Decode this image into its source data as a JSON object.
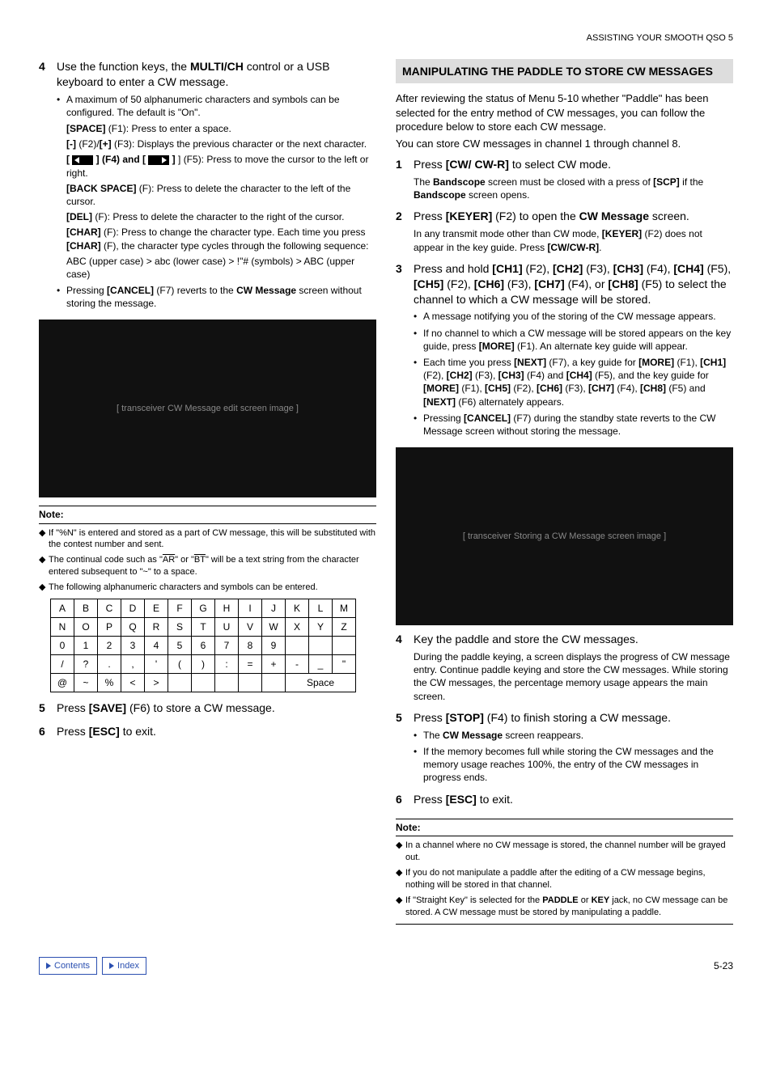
{
  "header": "ASSISTING YOUR SMOOTH QSO 5",
  "left": {
    "step4": {
      "num": "4",
      "head_a": "Use the function keys, the ",
      "head_b": "MULTI/CH",
      "head_c": " control or a USB keyboard to enter a CW message.",
      "b1": "A maximum of 50 alphanumeric characters and symbols can be configured. The default is \"On\".",
      "space_a": "[SPACE]",
      "space_b": " (F1): Press to enter a space.",
      "minus_a": "[-]",
      "minus_b": " (F2)/",
      "minus_c": "[+]",
      "minus_d": " (F3): Displays the previous character or the next character.",
      "arrow_a": "[ ",
      "arrow_b": " ] (F4) and [ ",
      "arrow_c": " ] (F5): Press to move the cursor to the left or right.",
      "back_a": "[BACK SPACE]",
      "back_b": " (F): Press to delete the character to the left of the cursor.",
      "del_a": "[DEL]",
      "del_b": " (F): Press to delete the character to the right of the cursor.",
      "char_a": "[CHAR]",
      "char_b": " (F): Press to change the character type. Each time you press ",
      "char_c": "[CHAR]",
      "char_d": " (F), the character type cycles through the following sequence:",
      "seq": "ABC (upper case) > abc (lower case) > !\"# (symbols) > ABC (upper case)",
      "cancel_a": "Pressing ",
      "cancel_b": "[CANCEL]",
      "cancel_c": " (F7) reverts to the ",
      "cancel_d": "CW Message",
      "cancel_e": " screen without storing the message."
    },
    "img1": "[ transceiver CW Message edit screen image ]",
    "note_head": "Note:",
    "n1": "If \"%N\" is entered and stored as a part of CW message, this will be substituted with the contest number and sent.",
    "n2_a": "The continual code  such as \"",
    "n2_b": "AR",
    "n2_c": "\" or \"",
    "n2_d": "BT",
    "n2_e": "\" will be a text string from the character entered subsequent to \"~\" to a space.",
    "n3": "The following alphanumeric characters and symbols can be entered.",
    "table": [
      [
        "A",
        "B",
        "C",
        "D",
        "E",
        "F",
        "G",
        "H",
        "I",
        "J",
        "K",
        "L",
        "M"
      ],
      [
        "N",
        "O",
        "P",
        "Q",
        "R",
        "S",
        "T",
        "U",
        "V",
        "W",
        "X",
        "Y",
        "Z"
      ],
      [
        "0",
        "1",
        "2",
        "3",
        "4",
        "5",
        "6",
        "7",
        "8",
        "9",
        "",
        "",
        ""
      ],
      [
        "/",
        "?",
        ".",
        ",",
        "'",
        "(",
        ")",
        ":",
        "=",
        "+",
        "-",
        "_",
        "\""
      ],
      [
        "@",
        "~",
        "%",
        "<",
        ">",
        "",
        "",
        "",
        "",
        "",
        "Space",
        "",
        ""
      ]
    ],
    "step5": {
      "num": "5",
      "a": "Press ",
      "b": "[SAVE]",
      "c": " (F6) to store a CW message."
    },
    "step6": {
      "num": "6",
      "a": "Press ",
      "b": "[ESC]",
      "c": " to exit."
    }
  },
  "right": {
    "section": "MANIPULATING THE PADDLE TO STORE CW MESSAGES",
    "intro1": "After reviewing the status of Menu 5-10 whether \"Paddle\" has been selected for the entry method of CW messages, you can follow the procedure below to store each CW message.",
    "intro2": "You can store CW messages in channel 1 through channel 8.",
    "s1": {
      "num": "1",
      "a": "Press ",
      "b": "[CW/ CW-R]",
      "c": " to select CW mode.",
      "d": "The ",
      "e": "Bandscope",
      "f": " screen must be closed with a press of ",
      "g": "[SCP]",
      "h": " if the ",
      "i": "Bandscope",
      "j": " screen opens."
    },
    "s2": {
      "num": "2",
      "a": "Press ",
      "b": "[KEYER]",
      "c": " (F2) to open the ",
      "d": "CW Message",
      "e": " screen.",
      "f": "In any transmit mode other than CW mode, ",
      "g": "[KEYER]",
      "h": " (F2) does not appear in the key guide. Press ",
      "i": "[CW/CW-R]",
      "j": "."
    },
    "s3": {
      "num": "3",
      "a": "Press and hold ",
      "b": "[CH1]",
      "c": " (F2), ",
      "d": "[CH2]",
      "e": " (F3), ",
      "f": "[CH3]",
      "g": " (F4), ",
      "h": "[CH4]",
      "i": " (F5), ",
      "j": "[CH5]",
      "k": " (F2), ",
      "l": "[CH6]",
      "m": " (F3), ",
      "n": "[CH7]",
      "o": " (F4), or ",
      "p": "[CH8]",
      "q": " (F5) to select the channel to which a CW message will be stored.",
      "b1": "A message notifying you of the storing of the CW message appears.",
      "b2_a": "If no channel to which a CW message will be stored appears on the key guide, press ",
      "b2_b": "[MORE]",
      "b2_c": " (F1). An alternate key guide will appear.",
      "b3_a": "Each time you press ",
      "b3_b": "[NEXT]",
      "b3_c": " (F7), a key guide for ",
      "b3_d": "[MORE]",
      "b3_e": " (F1), ",
      "b3_f": "[CH1]",
      "b3_g": " (F2), ",
      "b3_h": "[CH2]",
      "b3_i": " (F3), ",
      "b3_j": "[CH3]",
      "b3_k": " (F4) and ",
      "b3_l": "[CH4]",
      "b3_m": " (F5), and the key guide for ",
      "b3_n": "[MORE]",
      "b3_o": " (F1), ",
      "b3_p": "[CH5]",
      "b3_q": " (F2), ",
      "b3_r": "[CH6]",
      "b3_s": " (F3), ",
      "b3_t": "[CH7]",
      "b3_u": " (F4), ",
      "b3_v": "[CH8]",
      "b3_w": " (F5) and ",
      "b3_x": "[NEXT]",
      "b3_y": " (F6) alternately appears.",
      "b4_a": "Pressing ",
      "b4_b": "[CANCEL]",
      "b4_c": " (F7) during the standby state reverts to the CW Message screen without storing the message."
    },
    "img2": "[ transceiver Storing a CW Message screen image ]",
    "s4": {
      "num": "4",
      "head": "Key the paddle and store the CW messages.",
      "body": "During the paddle keying, a screen displays the progress of CW message entry. Continue paddle keying and store the CW messages. While storing the CW messages, the percentage memory usage appears the main screen."
    },
    "s5": {
      "num": "5",
      "a": "Press ",
      "b": "[STOP]",
      "c": " (F4) to finish storing a CW message.",
      "b1_a": "The ",
      "b1_b": "CW Message",
      "b1_c": " screen reappears.",
      "b2": "If the memory becomes full while storing the CW messages and the memory usage reaches 100%, the entry of the CW messages in progress ends."
    },
    "s6": {
      "num": "6",
      "a": "Press ",
      "b": "[ESC]",
      "c": " to exit."
    },
    "note_head": "Note:",
    "n1": "In a channel where no CW message is stored, the channel number will be grayed out.",
    "n2": "If you do not manipulate a paddle after the editing of a CW message begins, nothing will be stored in that channel.",
    "n3_a": "If \"Straight Key\" is selected for the ",
    "n3_b": "PADDLE",
    "n3_c": " or ",
    "n3_d": "KEY",
    "n3_e": " jack, no CW message can be stored. A CW message must be stored by manipulating a paddle."
  },
  "footer": {
    "contents": "Contents",
    "index": "Index",
    "page": "5-23"
  }
}
